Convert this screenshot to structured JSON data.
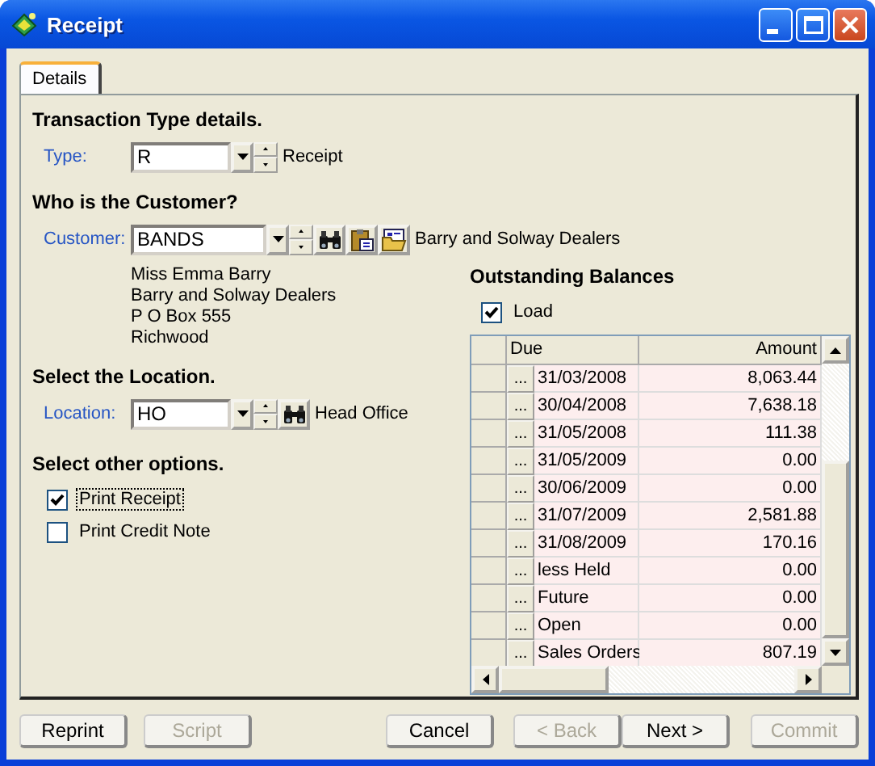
{
  "window": {
    "title": "Receipt"
  },
  "tabs": [
    {
      "label": "Details",
      "selected": true
    }
  ],
  "transaction": {
    "heading": "Transaction Type details.",
    "label": "Type:",
    "value": "R",
    "name": "Receipt"
  },
  "customer": {
    "heading": "Who is the Customer?",
    "label": "Customer:",
    "value": "BANDS",
    "name": "Barry and Solway Dealers",
    "address": [
      "Miss Emma Barry",
      "Barry and Solway Dealers",
      "P O Box 555",
      "Richwood"
    ]
  },
  "location": {
    "heading": "Select the Location.",
    "label": "Location:",
    "value": "HO",
    "name": "Head Office"
  },
  "options": {
    "heading": "Select other options.",
    "items": [
      {
        "label": "Print Receipt",
        "checked": true,
        "focused": true
      },
      {
        "label": "Print Credit Note",
        "checked": false,
        "focused": false
      }
    ]
  },
  "balances": {
    "heading": "Outstanding Balances",
    "load": {
      "label": "Load",
      "checked": true
    },
    "columns": [
      "Due",
      "Amount"
    ],
    "rows": [
      {
        "due": "31/03/2008",
        "amount": "8,063.44"
      },
      {
        "due": "30/04/2008",
        "amount": "7,638.18"
      },
      {
        "due": "31/05/2008",
        "amount": "111.38"
      },
      {
        "due": "31/05/2009",
        "amount": "0.00"
      },
      {
        "due": "30/06/2009",
        "amount": "0.00"
      },
      {
        "due": "31/07/2009",
        "amount": "2,581.88"
      },
      {
        "due": "31/08/2009",
        "amount": "170.16"
      },
      {
        "due": "less Held",
        "amount": "0.00"
      },
      {
        "due": "Future",
        "amount": "0.00"
      },
      {
        "due": "Open",
        "amount": "0.00"
      },
      {
        "due": "Sales Orders",
        "amount": "807.19"
      }
    ],
    "cell_button": "..."
  },
  "buttons": [
    {
      "label": "Reprint",
      "disabled": false
    },
    {
      "label": "Script",
      "disabled": true
    },
    {
      "label": "Cancel",
      "disabled": false
    },
    {
      "label": "< Back",
      "disabled": true
    },
    {
      "label": "Next >",
      "disabled": false
    },
    {
      "label": "Commit",
      "disabled": true
    }
  ]
}
